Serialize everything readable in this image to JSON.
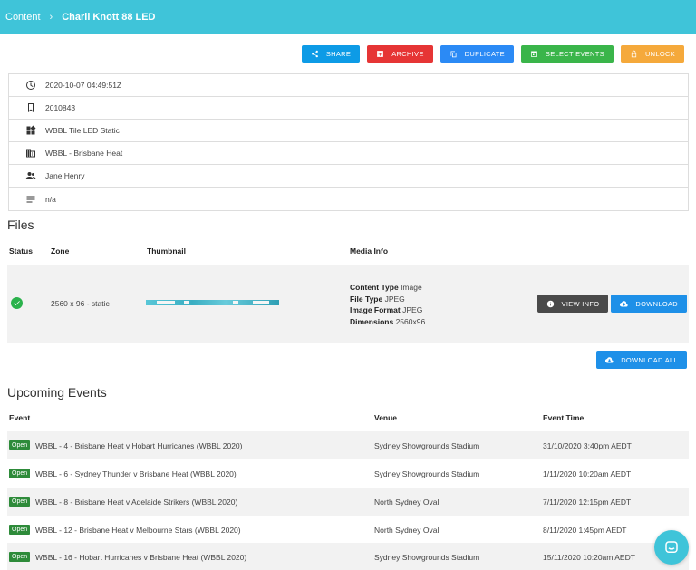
{
  "breadcrumb": {
    "parent": "Content",
    "separator": "›",
    "current": "Charli Knott 88 LED"
  },
  "actions": {
    "share": "SHARE",
    "archive": "ARCHIVE",
    "duplicate": "DUPLICATE",
    "select_events": "SELECT EVENTS",
    "unlock": "UNLOCK"
  },
  "details": [
    {
      "icon": "clock-icon",
      "value": "2020-10-07 04:49:51Z"
    },
    {
      "icon": "bookmark-icon",
      "value": "2010843"
    },
    {
      "icon": "widgets-icon",
      "value": "WBBL Tile LED Static"
    },
    {
      "icon": "building-icon",
      "value": "WBBL - Brisbane Heat"
    },
    {
      "icon": "people-icon",
      "value": "Jane Henry"
    },
    {
      "icon": "notes-icon",
      "value": "n/a"
    }
  ],
  "files": {
    "title": "Files",
    "columns": {
      "status": "Status",
      "zone": "Zone",
      "thumbnail": "Thumbnail",
      "media_info": "Media Info"
    },
    "rows": [
      {
        "status": "check-circle-icon",
        "zone": "2560 x 96 - static",
        "media": {
          "content_type_label": "Content Type",
          "content_type": "Image",
          "file_type_label": "File Type",
          "file_type": "JPEG",
          "image_format_label": "Image Format",
          "image_format": "JPEG",
          "dimensions_label": "Dimensions",
          "dimensions": "2560x96"
        },
        "view_info": "VIEW INFO",
        "download": "DOWNLOAD"
      }
    ],
    "download_all": "DOWNLOAD ALL"
  },
  "events": {
    "title": "Upcoming Events",
    "columns": {
      "event": "Event",
      "venue": "Venue",
      "time": "Event Time"
    },
    "rows": [
      {
        "status": "Open",
        "name": "WBBL - 4 - Brisbane Heat v Hobart Hurricanes (WBBL 2020)",
        "venue": "Sydney Showgrounds Stadium",
        "time": "31/10/2020 3:40pm AEDT"
      },
      {
        "status": "Open",
        "name": "WBBL - 6 - Sydney Thunder v Brisbane Heat (WBBL 2020)",
        "venue": "Sydney Showgrounds Stadium",
        "time": "1/11/2020 10:20am AEDT"
      },
      {
        "status": "Open",
        "name": "WBBL - 8 - Brisbane Heat v Adelaide Strikers (WBBL 2020)",
        "venue": "North Sydney Oval",
        "time": "7/11/2020 12:15pm AEDT"
      },
      {
        "status": "Open",
        "name": "WBBL - 12 - Brisbane Heat v Melbourne Stars (WBBL 2020)",
        "venue": "North Sydney Oval",
        "time": "8/11/2020 1:45pm AEDT"
      },
      {
        "status": "Open",
        "name": "WBBL - 16 - Hobart Hurricanes v Brisbane Heat (WBBL 2020)",
        "venue": "Sydney Showgrounds Stadium",
        "time": "15/11/2020 10:20am AEDT"
      }
    ]
  },
  "colors": {
    "header": "#3fc4d9",
    "share": "#0d9be6",
    "archive": "#e63535",
    "duplicate": "#2b8af5",
    "select_events": "#3ab54a",
    "unlock": "#f5a93b",
    "open_badge": "#2e8b3a"
  }
}
